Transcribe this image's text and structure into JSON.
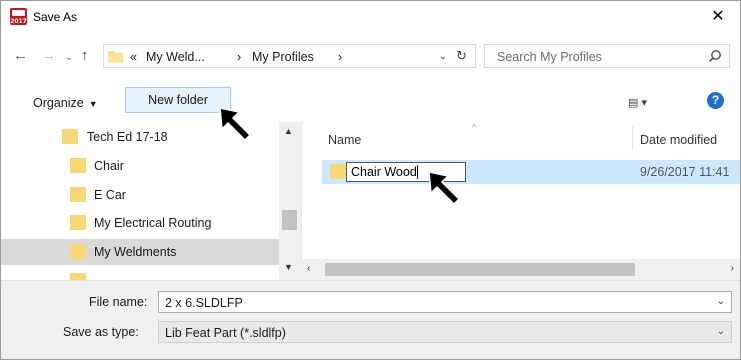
{
  "window": {
    "title": "Save As",
    "app_icon_text": "2017",
    "close_symbol": "✕"
  },
  "nav": {
    "back_symbol": "←",
    "forward_symbol": "→",
    "recent_symbol": "⌄",
    "up_symbol": "↑",
    "breadcrumb_overflow": "«",
    "breadcrumb": [
      "My Weld...",
      "My Profiles"
    ],
    "breadcrumb_sep": "›",
    "dropdown_symbol": "⌄",
    "refresh_symbol": "↻",
    "search_placeholder": "Search My Profiles"
  },
  "toolbar": {
    "organize_label": "Organize",
    "organize_arrow": "▼",
    "new_folder_label": "New folder",
    "view_symbol": "▤ ▾",
    "help_symbol": "?"
  },
  "tree": {
    "items": [
      {
        "label": "Tech Ed 17-18",
        "indent": 1,
        "selected": false
      },
      {
        "label": "Chair",
        "indent": 2,
        "selected": false
      },
      {
        "label": "E Car",
        "indent": 2,
        "selected": false
      },
      {
        "label": "My Electrical Routing",
        "indent": 2,
        "selected": false
      },
      {
        "label": "My Weldments",
        "indent": 2,
        "selected": true
      }
    ],
    "scroll_up": "▲",
    "scroll_down": "▼"
  },
  "list": {
    "columns": {
      "name": "Name",
      "date": "Date modified"
    },
    "sort_indicator": "^",
    "rows": [
      {
        "name": "Chair Wood",
        "date": "9/26/2017 11:41"
      }
    ],
    "scroll_left": "‹",
    "scroll_right": "›"
  },
  "form": {
    "file_name_label": "File name:",
    "file_name_value": "2 x 6.SLDLFP",
    "save_type_label": "Save as type:",
    "save_type_value": "Lib Feat Part (*.sldlfp)",
    "dropdown_symbol": "⌄"
  },
  "colors": {
    "folder_yellow": "#f8d775",
    "selection_blue": "#cce8ff",
    "accent_blue": "#1d6fd0"
  }
}
